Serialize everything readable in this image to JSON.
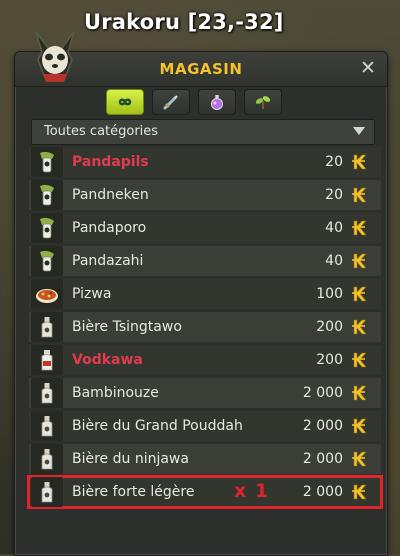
{
  "map": {
    "title": "Urakoru [23,-32]"
  },
  "window": {
    "title": "MAGASIN",
    "close_label": "✕",
    "tabs": [
      {
        "icon": "infinity-icon",
        "active": true
      },
      {
        "icon": "sword-icon",
        "active": false
      },
      {
        "icon": "potion-icon",
        "active": false
      },
      {
        "icon": "plant-icon",
        "active": false
      }
    ],
    "filter": {
      "selected": "Toutes catégories"
    }
  },
  "items": [
    {
      "name": "Pandapils",
      "price": "20",
      "icon": "pandapils-bottle-icon",
      "highlight": true
    },
    {
      "name": "Pandneken",
      "price": "20",
      "icon": "pandneken-bottle-icon",
      "highlight": false
    },
    {
      "name": "Pandaporo",
      "price": "40",
      "icon": "pandaporo-bottle-icon",
      "highlight": false
    },
    {
      "name": "Pandazahi",
      "price": "40",
      "icon": "pandazahi-bottle-icon",
      "highlight": false
    },
    {
      "name": "Pizwa",
      "price": "100",
      "icon": "pizza-icon",
      "highlight": false
    },
    {
      "name": "Bière Tsingtawo",
      "price": "200",
      "icon": "beer-bottle-icon",
      "highlight": false
    },
    {
      "name": "Vodkawa",
      "price": "200",
      "icon": "vodka-bottle-icon",
      "highlight": true
    },
    {
      "name": "Bambinouze",
      "price": "2 000",
      "icon": "bottle-icon",
      "highlight": false
    },
    {
      "name": "Bière du Grand Pouddah",
      "price": "2 000",
      "icon": "bottle-icon",
      "highlight": false
    },
    {
      "name": "Bière du ninjawa",
      "price": "2 000",
      "icon": "bottle-icon",
      "highlight": false
    },
    {
      "name": "Bière forte légère",
      "price": "2 000",
      "icon": "bottle-icon",
      "highlight": false
    }
  ],
  "selection": {
    "quantity_label": "x 1"
  },
  "colors": {
    "accent": "#f3c22c",
    "highlight_name": "#e23b4e",
    "selection": "#e0242b"
  }
}
